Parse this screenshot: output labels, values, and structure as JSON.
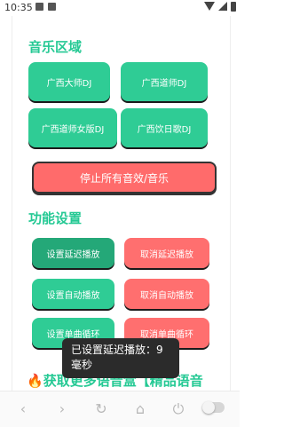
{
  "status": {
    "time": "10:35"
  },
  "music": {
    "title": "音乐区域",
    "buttons": [
      "广西大师DJ",
      "广西道师DJ",
      "广西道师女版DJ",
      "广西饮日歌DJ"
    ],
    "stop_all": "停止所有音效/音乐"
  },
  "settings": {
    "title": "功能设置",
    "set_delay": "设置延迟播放",
    "cancel_delay": "取消延迟播放",
    "set_auto": "设置自动播放",
    "cancel_auto": "取消自动播放",
    "set_loop": "设置单曲循环",
    "cancel_loop": "取消单曲循环"
  },
  "toast": {
    "line1": "已设置延迟播放：9",
    "line2": "毫秒"
  },
  "promo": {
    "text": "获取更多语音盒【精品语音"
  },
  "nav": {
    "icons": [
      "back-icon",
      "forward-icon",
      "refresh-icon",
      "home-icon",
      "power-icon"
    ]
  },
  "colors": {
    "accent_green": "#2fcc95",
    "pressed_green": "#24a878",
    "red": "#ff6f6f",
    "title_green": "#25c994"
  }
}
